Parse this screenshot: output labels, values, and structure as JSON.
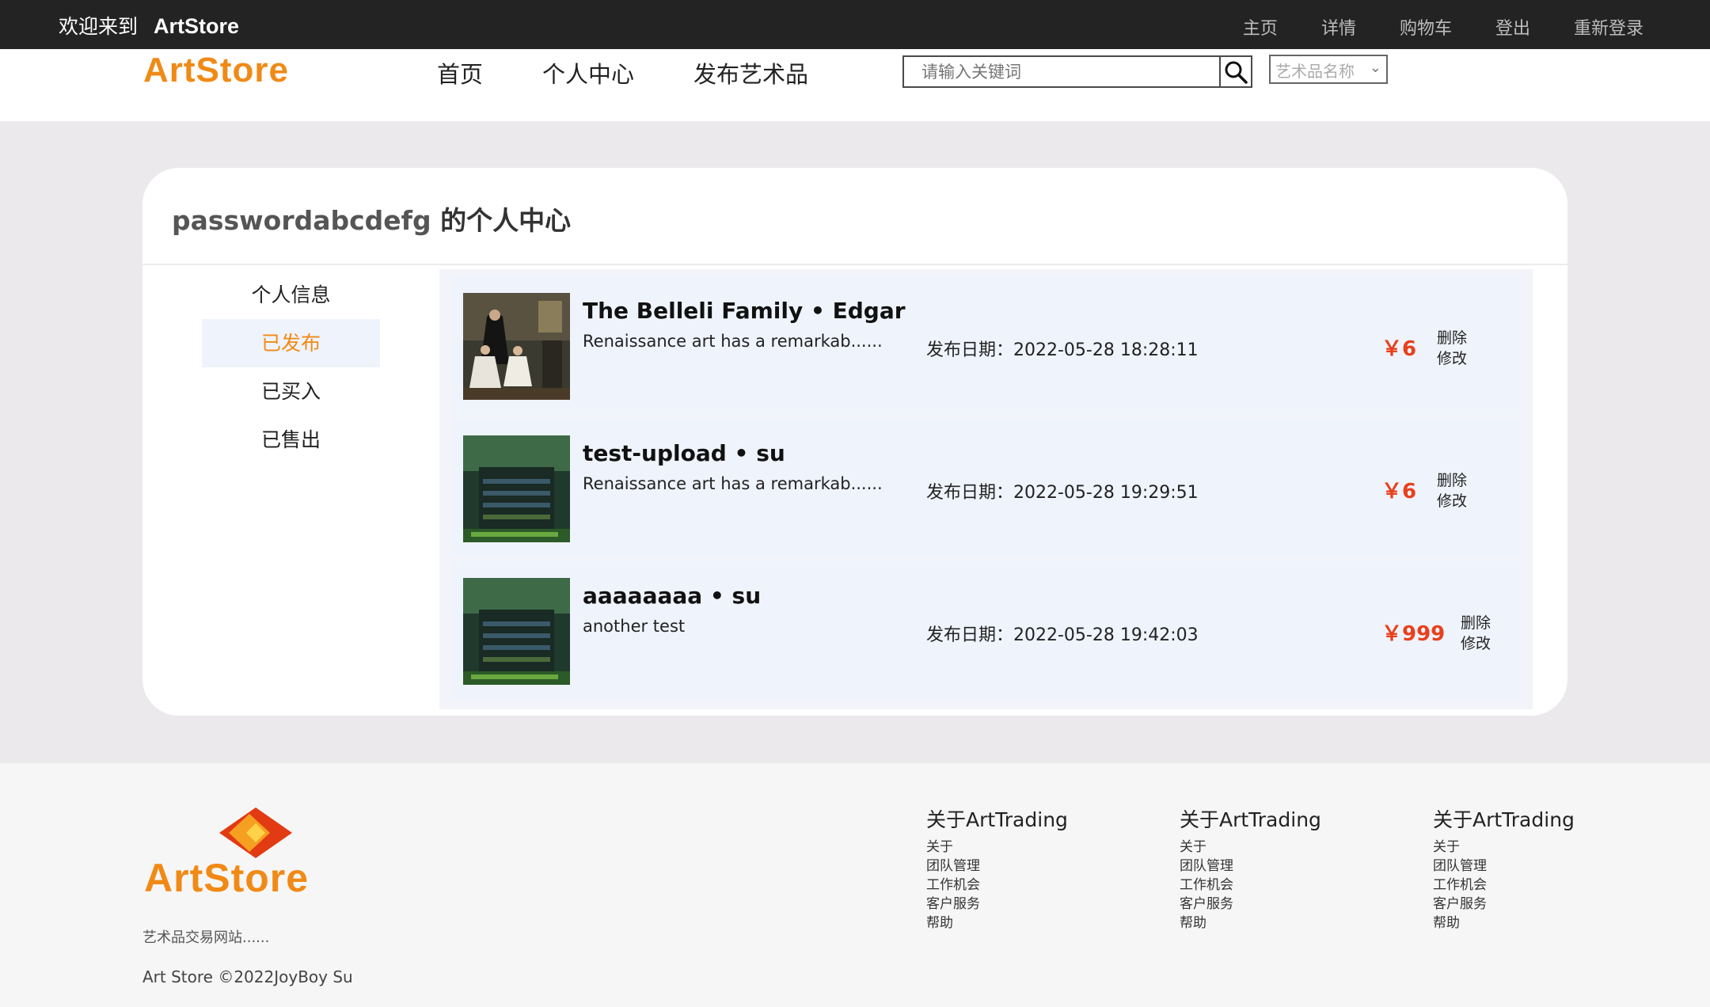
{
  "topbar": {
    "welcome": "欢迎来到",
    "brand": "ArtStore",
    "links": [
      "主页",
      "详情",
      "购物车",
      "登出",
      "重新登录"
    ]
  },
  "header": {
    "logo": "ArtStore",
    "nav": [
      "首页",
      "个人中心",
      "发布艺术品"
    ],
    "search_placeholder": "请输入关键词",
    "select_value": "艺术品名称"
  },
  "profile": {
    "username": "passwordabcdefg",
    "title_suffix": " 的个人中心",
    "sidebar": [
      "个人信息",
      "已发布",
      "已买入",
      "已售出"
    ],
    "active_index": 1
  },
  "artworks": [
    {
      "title": "The Belleli Family • Edgar",
      "desc": "Renaissance art has a remarkab......",
      "date": "发布日期：2022-05-28 18:28:11",
      "price": "￥6",
      "delete": "删除",
      "edit": "修改"
    },
    {
      "title": "test-upload • su",
      "desc": "Renaissance art has a remarkab......",
      "date": "发布日期：2022-05-28 19:29:51",
      "price": "￥6",
      "delete": "删除",
      "edit": "修改"
    },
    {
      "title": "aaaaaaaa • su",
      "desc": "another test",
      "date": "发布日期：2022-05-28 19:42:03",
      "price": "￥999",
      "delete": "删除",
      "edit": "修改"
    }
  ],
  "footer": {
    "logo": "ArtStore",
    "desc": "艺术品交易网站......",
    "copyright": "Art Store ©2022JoyBoy Su",
    "columns": [
      {
        "heading": "关于ArtTrading",
        "links": [
          "关于",
          "团队管理",
          "工作机会",
          "客户服务",
          "帮助"
        ]
      },
      {
        "heading": "关于ArtTrading",
        "links": [
          "关于",
          "团队管理",
          "工作机会",
          "客户服务",
          "帮助"
        ]
      },
      {
        "heading": "关于ArtTrading",
        "links": [
          "关于",
          "团队管理",
          "工作机会",
          "客户服务",
          "帮助"
        ]
      }
    ]
  },
  "colors": {
    "accent": "#f08a16",
    "price": "#e8401c",
    "topbar": "#232323"
  }
}
